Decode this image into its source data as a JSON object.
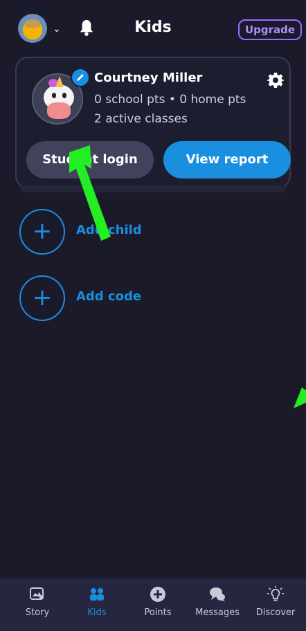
{
  "header": {
    "title": "Kids",
    "upgrade_label": "Upgrade"
  },
  "child": {
    "name": "Courtney Miller",
    "points": "0 school pts • 0 home pts",
    "classes": "2 active classes",
    "login_label": "Student login",
    "report_label": "View report"
  },
  "actions": {
    "add_child": "Add child",
    "add_code": "Add code"
  },
  "nav": {
    "items": [
      {
        "label": "Story",
        "icon": "story-icon"
      },
      {
        "label": "Kids",
        "icon": "kids-icon",
        "active": true
      },
      {
        "label": "Points",
        "icon": "points-icon"
      },
      {
        "label": "Messages",
        "icon": "messages-icon"
      },
      {
        "label": "Discover",
        "icon": "discover-icon"
      }
    ]
  },
  "colors": {
    "background": "#1a1a2a",
    "accent": "#1a8fe0",
    "upgrade": "#9b6cff",
    "annotation_arrow": "#22ee22"
  }
}
